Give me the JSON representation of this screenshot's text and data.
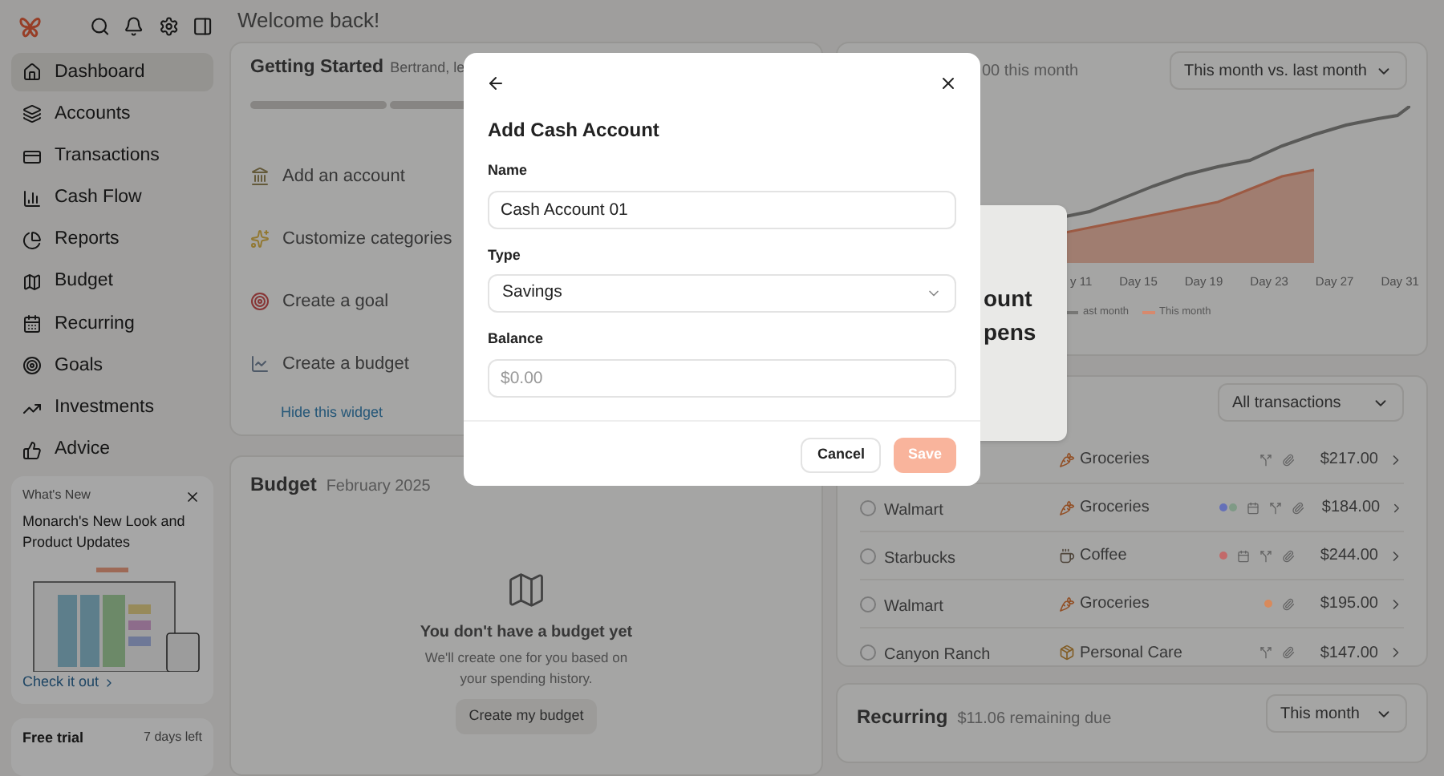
{
  "topbar": {
    "header": "Welcome back!"
  },
  "sidebar": {
    "items": [
      {
        "label": "Dashboard",
        "selected": true
      },
      {
        "label": "Accounts",
        "selected": false
      },
      {
        "label": "Transactions",
        "selected": false
      },
      {
        "label": "Cash Flow",
        "selected": false
      },
      {
        "label": "Reports",
        "selected": false
      },
      {
        "label": "Budget",
        "selected": false
      },
      {
        "label": "Recurring",
        "selected": false
      },
      {
        "label": "Goals",
        "selected": false
      },
      {
        "label": "Investments",
        "selected": false
      },
      {
        "label": "Advice",
        "selected": false
      }
    ],
    "whats_new": {
      "eyebrow": "What's New",
      "title": "Monarch's New Look and Product Updates",
      "link": "Check it out"
    },
    "trial": {
      "title": "Free trial",
      "remaining": "7 days left"
    }
  },
  "getting_started": {
    "title": "Getting Started",
    "subtitle": "Bertrand, le",
    "items": [
      {
        "label": "Add an account"
      },
      {
        "label": "Customize categories"
      },
      {
        "label": "Create a goal"
      },
      {
        "label": "Create a budget"
      }
    ],
    "hide_link": "Hide this widget"
  },
  "budget": {
    "title": "Budget",
    "subtitle": "February 2025",
    "empty_title": "You don't have a budget yet",
    "empty_text": "We'll create one for you based on your spending history.",
    "button": "Create my budget"
  },
  "spending": {
    "summary": "00 this month",
    "period": "This month vs. last month",
    "x_labels": [
      "y 11",
      "Day 15",
      "Day 19",
      "Day 23",
      "Day 27",
      "Day 31"
    ],
    "legend": [
      {
        "label": "ast month",
        "color": "#777775"
      },
      {
        "label": "This month",
        "color": "#d7896d"
      }
    ]
  },
  "popover": {
    "lines": [
      "ount",
      "pens"
    ]
  },
  "transactions": {
    "filter": "All transactions",
    "rows": [
      {
        "category": "Groceries",
        "tags": [],
        "amount": "$217.00"
      },
      {
        "checked": false,
        "merchant": "Walmart",
        "category": "Groceries",
        "tags": [
          {
            "color": "#6570b8"
          },
          {
            "color": "#7f9a86"
          }
        ],
        "amount": "$184.00"
      },
      {
        "checked": false,
        "merchant": "Starbucks",
        "category": "Coffee",
        "tags": [
          {
            "color": "#c26a6a"
          }
        ],
        "amount": "$244.00"
      },
      {
        "checked": false,
        "merchant": "Walmart",
        "category": "Groceries",
        "tags": [
          {
            "color": "#d88a5c"
          }
        ],
        "amount": "$195.00"
      },
      {
        "checked": false,
        "merchant": "Canyon Ranch",
        "category": "Personal Care",
        "tags": [],
        "amount": "$147.00"
      }
    ]
  },
  "recurring": {
    "title": "Recurring",
    "subtitle": "$11.06 remaining due",
    "period": "This month"
  },
  "modal": {
    "title": "Add Cash Account",
    "fields": [
      {
        "kind": "text",
        "label": "Name",
        "value": "Cash Account 01"
      },
      {
        "kind": "select",
        "label": "Type",
        "value": "Savings"
      },
      {
        "kind": "text",
        "label": "Balance",
        "placeholder": "$0.00"
      }
    ],
    "buttons": [
      {
        "label": "Cancel",
        "kind": "secondary",
        "disabled": false
      },
      {
        "label": "Save",
        "kind": "primary",
        "disabled": true
      }
    ]
  }
}
